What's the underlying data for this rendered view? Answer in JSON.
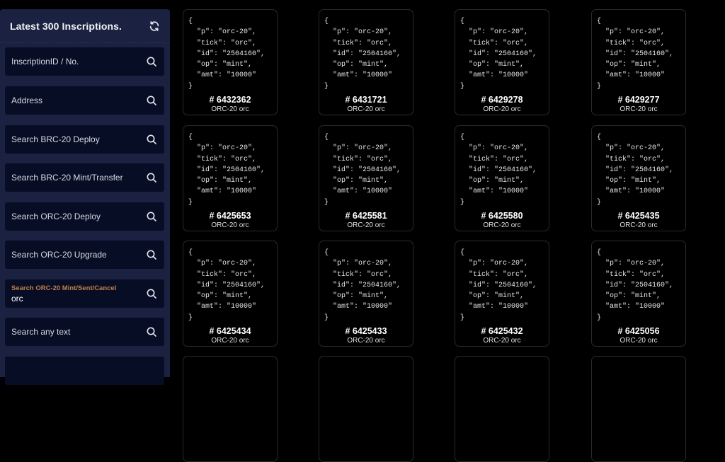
{
  "sidebar": {
    "title": "Latest 300 Inscriptions.",
    "refresh_icon": "refresh-icon",
    "searches": [
      {
        "placeholder": "InscriptionID / No.",
        "value": ""
      },
      {
        "placeholder": "Address",
        "value": ""
      },
      {
        "placeholder": "Search BRC-20 Deploy",
        "value": ""
      },
      {
        "placeholder": "Search BRC-20 Mint/Transfer",
        "value": ""
      },
      {
        "placeholder": "Search ORC-20 Deploy",
        "value": ""
      },
      {
        "placeholder": "Search ORC-20 Upgrade",
        "value": ""
      },
      {
        "label": "Search ORC-20 Mint/Sent/Cancel",
        "value": "orc"
      },
      {
        "placeholder": "Search any text",
        "value": ""
      }
    ],
    "label_color": "#c0804a"
  },
  "inscriptions": [
    {
      "number": "# 6432362",
      "type": "ORC-20 orc",
      "content": "{\n  \"p\": \"orc-20\",\n  \"tick\": \"orc\",\n  \"id\": \"2504160\",\n  \"op\": \"mint\",\n  \"amt\": \"10000\"\n}"
    },
    {
      "number": "# 6431721",
      "type": "ORC-20 orc",
      "content": "{\n  \"p\": \"orc-20\",\n  \"tick\": \"orc\",\n  \"id\": \"2504160\",\n  \"op\": \"mint\",\n  \"amt\": \"10000\"\n}"
    },
    {
      "number": "# 6429278",
      "type": "ORC-20 orc",
      "content": "{\n  \"p\": \"orc-20\",\n  \"tick\": \"orc\",\n  \"id\": \"2504160\",\n  \"op\": \"mint\",\n  \"amt\": \"10000\"\n}"
    },
    {
      "number": "# 6429277",
      "type": "ORC-20 orc",
      "content": "{\n  \"p\": \"orc-20\",\n  \"tick\": \"orc\",\n  \"id\": \"2504160\",\n  \"op\": \"mint\",\n  \"amt\": \"10000\"\n}"
    },
    {
      "number": "# 6425653",
      "type": "ORC-20 orc",
      "content": "{\n  \"p\": \"orc-20\",\n  \"tick\": \"orc\",\n  \"id\": \"2504160\",\n  \"op\": \"mint\",\n  \"amt\": \"10000\"\n}"
    },
    {
      "number": "# 6425581",
      "type": "ORC-20 orc",
      "content": "{\n  \"p\": \"orc-20\",\n  \"tick\": \"orc\",\n  \"id\": \"2504160\",\n  \"op\": \"mint\",\n  \"amt\": \"10000\"\n}"
    },
    {
      "number": "# 6425580",
      "type": "ORC-20 orc",
      "content": "{\n  \"p\": \"orc-20\",\n  \"tick\": \"orc\",\n  \"id\": \"2504160\",\n  \"op\": \"mint\",\n  \"amt\": \"10000\"\n}"
    },
    {
      "number": "# 6425435",
      "type": "ORC-20 orc",
      "content": "{\n  \"p\": \"orc-20\",\n  \"tick\": \"orc\",\n  \"id\": \"2504160\",\n  \"op\": \"mint\",\n  \"amt\": \"10000\"\n}"
    },
    {
      "number": "# 6425434",
      "type": "ORC-20 orc",
      "content": "{\n  \"p\": \"orc-20\",\n  \"tick\": \"orc\",\n  \"id\": \"2504160\",\n  \"op\": \"mint\",\n  \"amt\": \"10000\"\n}"
    },
    {
      "number": "# 6425433",
      "type": "ORC-20 orc",
      "content": "{\n  \"p\": \"orc-20\",\n  \"tick\": \"orc\",\n  \"id\": \"2504160\",\n  \"op\": \"mint\",\n  \"amt\": \"10000\"\n}"
    },
    {
      "number": "# 6425432",
      "type": "ORC-20 orc",
      "content": "{\n  \"p\": \"orc-20\",\n  \"tick\": \"orc\",\n  \"id\": \"2504160\",\n  \"op\": \"mint\",\n  \"amt\": \"10000\"\n}"
    },
    {
      "number": "# 6425056",
      "type": "ORC-20 orc",
      "content": "{\n  \"p\": \"orc-20\",\n  \"tick\": \"orc\",\n  \"id\": \"2504160\",\n  \"op\": \"mint\",\n  \"amt\": \"10000\"\n}"
    }
  ]
}
